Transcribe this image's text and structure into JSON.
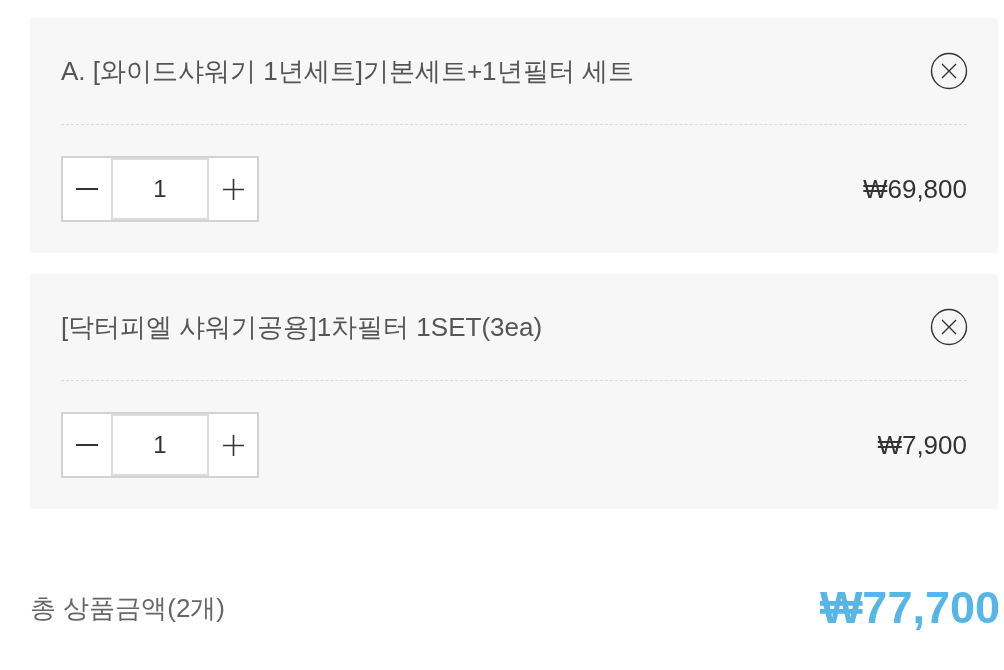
{
  "items": [
    {
      "name": "A. [와이드샤워기 1년세트]기본세트+1년필터 세트",
      "quantity": "1",
      "price": "₩69,800"
    },
    {
      "name": "[닥터피엘 샤워기공용]1차필터 1SET(3ea)",
      "quantity": "1",
      "price": "₩7,900"
    }
  ],
  "total": {
    "label": "총 상품금액(2개)",
    "amount": "₩77,700"
  }
}
